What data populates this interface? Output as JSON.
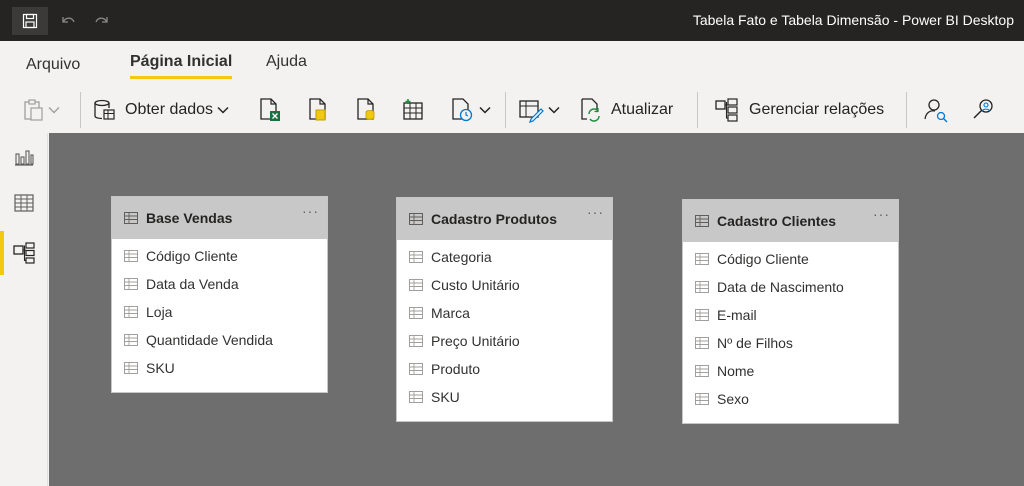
{
  "window": {
    "title": "Tabela Fato e Tabela Dimensão - Power BI Desktop"
  },
  "menu": {
    "tabs": [
      "Arquivo",
      "Página Inicial",
      "Ajuda"
    ],
    "active": "Página Inicial"
  },
  "ribbon": {
    "get_data": "Obter dados",
    "refresh": "Atualizar",
    "manage_relationships": "Gerenciar relações"
  },
  "colors": {
    "accent": "#f2c811",
    "titlebar": "#252423",
    "canvas": "#6e6e6e",
    "card_header": "#c8c8c8"
  },
  "tables": [
    {
      "name": "Base Vendas",
      "fields": [
        "Código Cliente",
        "Data da Venda",
        "Loja",
        "Quantidade Vendida",
        "SKU"
      ]
    },
    {
      "name": "Cadastro Produtos",
      "fields": [
        "Categoria",
        "Custo Unitário",
        "Marca",
        "Preço Unitário",
        "Produto",
        "SKU"
      ]
    },
    {
      "name": "Cadastro Clientes",
      "fields": [
        "Código Cliente",
        "Data de Nascimento",
        "E-mail",
        "Nº de Filhos",
        "Nome",
        "Sexo"
      ]
    }
  ]
}
